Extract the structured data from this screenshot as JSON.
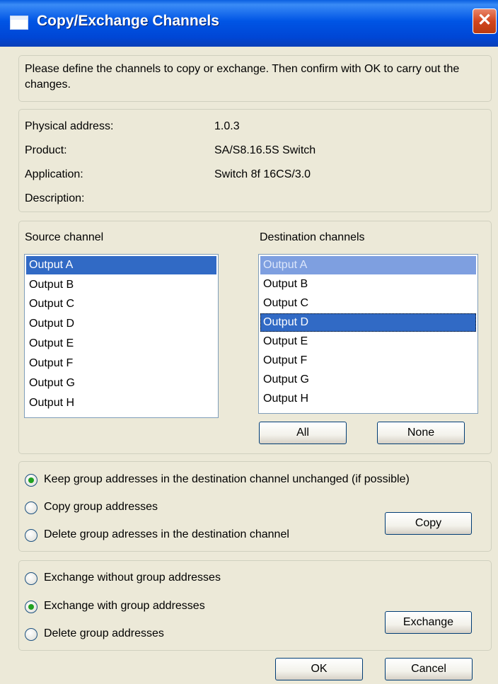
{
  "window": {
    "title": "Copy/Exchange Channels",
    "close_glyph": "✕"
  },
  "intro": {
    "text": "Please define the channels to copy or exchange. Then confirm with OK to carry out the changes."
  },
  "info": {
    "rows": [
      {
        "label": "Physical address:",
        "value": "1.0.3"
      },
      {
        "label": "Product:",
        "value": "SA/S8.16.5S Switch"
      },
      {
        "label": "Application:",
        "value": "Switch 8f 16CS/3.0"
      },
      {
        "label": "Description:",
        "value": ""
      }
    ]
  },
  "channels": {
    "source_label": "Source channel",
    "destination_label": "Destination channels",
    "source_items": [
      "Output A",
      "Output B",
      "Output C",
      "Output D",
      "Output E",
      "Output F",
      "Output G",
      "Output H"
    ],
    "source_selected": "Output A",
    "destination_items": [
      "Output A",
      "Output B",
      "Output C",
      "Output D",
      "Output E",
      "Output F",
      "Output G",
      "Output H"
    ],
    "destination_disabled_selected": "Output A",
    "destination_selected": "Output D",
    "all_button": "All",
    "none_button": "None"
  },
  "copy_options": {
    "options": [
      {
        "label": "Keep group addresses in the destination channel unchanged (if possible)",
        "checked": true
      },
      {
        "label": "Copy group addresses",
        "checked": false
      },
      {
        "label": "Delete group adresses in the destination channel",
        "checked": false
      }
    ],
    "button": "Copy"
  },
  "exchange_options": {
    "options": [
      {
        "label": "Exchange without group addresses",
        "checked": false
      },
      {
        "label": "Exchange with group addresses",
        "checked": true
      },
      {
        "label": "Delete group addresses",
        "checked": false
      }
    ],
    "button": "Exchange"
  },
  "footer": {
    "ok": "OK",
    "cancel": "Cancel"
  },
  "colors": {
    "title_bar": "#0055E5",
    "selection": "#316AC5",
    "selection_inactive": "#7E9FE0",
    "dialog_bg": "#ECE9D8",
    "radio_dot": "#21A121",
    "close_button": "#D2451E"
  }
}
